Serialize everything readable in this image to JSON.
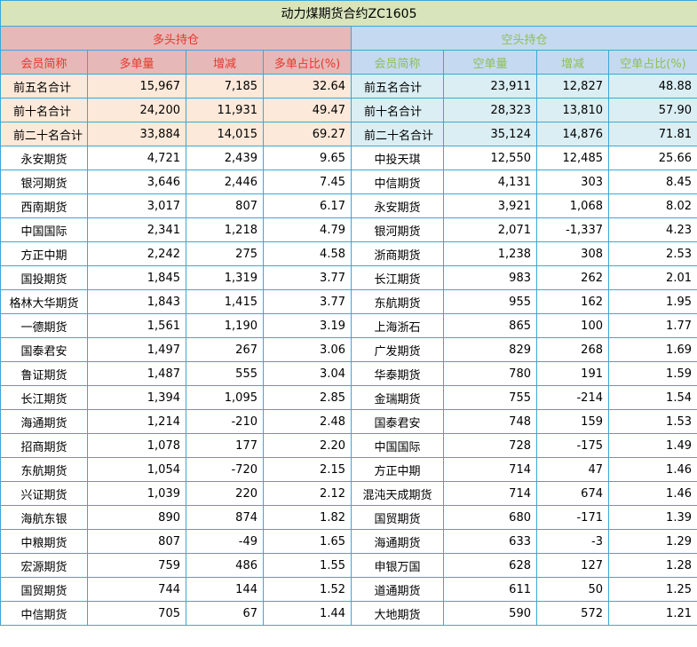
{
  "title": "动力煤期货合约ZC1605",
  "long_section": "多头持仓",
  "short_section": "空头持仓",
  "long_headers": [
    "会员简称",
    "多单量",
    "增减",
    "多单占比(%)"
  ],
  "short_headers": [
    "会员简称",
    "空单量",
    "增减",
    "空单占比(%)"
  ],
  "summary_rows": [
    {
      "long": [
        "前五名合计",
        "15,967",
        "7,185",
        "32.64"
      ],
      "short": [
        "前五名合计",
        "23,911",
        "12,827",
        "48.88"
      ]
    },
    {
      "long": [
        "前十名合计",
        "24,200",
        "11,931",
        "49.47"
      ],
      "short": [
        "前十名合计",
        "28,323",
        "13,810",
        "57.90"
      ]
    },
    {
      "long": [
        "前二十名合计",
        "33,884",
        "14,015",
        "69.27"
      ],
      "short": [
        "前二十名合计",
        "35,124",
        "14,876",
        "71.81"
      ]
    }
  ],
  "rows": [
    {
      "long": [
        "永安期货",
        "4,721",
        "2,439",
        "9.65"
      ],
      "short": [
        "中投天琪",
        "12,550",
        "12,485",
        "25.66"
      ]
    },
    {
      "long": [
        "银河期货",
        "3,646",
        "2,446",
        "7.45"
      ],
      "short": [
        "中信期货",
        "4,131",
        "303",
        "8.45"
      ]
    },
    {
      "long": [
        "西南期货",
        "3,017",
        "807",
        "6.17"
      ],
      "short": [
        "永安期货",
        "3,921",
        "1,068",
        "8.02"
      ]
    },
    {
      "long": [
        "中国国际",
        "2,341",
        "1,218",
        "4.79"
      ],
      "short": [
        "银河期货",
        "2,071",
        "-1,337",
        "4.23"
      ]
    },
    {
      "long": [
        "方正中期",
        "2,242",
        "275",
        "4.58"
      ],
      "short": [
        "浙商期货",
        "1,238",
        "308",
        "2.53"
      ]
    },
    {
      "long": [
        "国投期货",
        "1,845",
        "1,319",
        "3.77"
      ],
      "short": [
        "长江期货",
        "983",
        "262",
        "2.01"
      ]
    },
    {
      "long": [
        "格林大华期货",
        "1,843",
        "1,415",
        "3.77"
      ],
      "short": [
        "东航期货",
        "955",
        "162",
        "1.95"
      ]
    },
    {
      "long": [
        "一德期货",
        "1,561",
        "1,190",
        "3.19"
      ],
      "short": [
        "上海浙石",
        "865",
        "100",
        "1.77"
      ]
    },
    {
      "long": [
        "国泰君安",
        "1,497",
        "267",
        "3.06"
      ],
      "short": [
        "广发期货",
        "829",
        "268",
        "1.69"
      ]
    },
    {
      "long": [
        "鲁证期货",
        "1,487",
        "555",
        "3.04"
      ],
      "short": [
        "华泰期货",
        "780",
        "191",
        "1.59"
      ]
    },
    {
      "long": [
        "长江期货",
        "1,394",
        "1,095",
        "2.85"
      ],
      "short": [
        "金瑞期货",
        "755",
        "-214",
        "1.54"
      ]
    },
    {
      "long": [
        "海通期货",
        "1,214",
        "-210",
        "2.48"
      ],
      "short": [
        "国泰君安",
        "748",
        "159",
        "1.53"
      ]
    },
    {
      "long": [
        "招商期货",
        "1,078",
        "177",
        "2.20"
      ],
      "short": [
        "中国国际",
        "728",
        "-175",
        "1.49"
      ]
    },
    {
      "long": [
        "东航期货",
        "1,054",
        "-720",
        "2.15"
      ],
      "short": [
        "方正中期",
        "714",
        "47",
        "1.46"
      ]
    },
    {
      "long": [
        "兴证期货",
        "1,039",
        "220",
        "2.12"
      ],
      "short": [
        "混沌天成期货",
        "714",
        "674",
        "1.46"
      ]
    },
    {
      "long": [
        "海航东银",
        "890",
        "874",
        "1.82"
      ],
      "short": [
        "国贸期货",
        "680",
        "-171",
        "1.39"
      ]
    },
    {
      "long": [
        "中粮期货",
        "807",
        "-49",
        "1.65"
      ],
      "short": [
        "海通期货",
        "633",
        "-3",
        "1.29"
      ]
    },
    {
      "long": [
        "宏源期货",
        "759",
        "486",
        "1.55"
      ],
      "short": [
        "申银万国",
        "628",
        "127",
        "1.28"
      ]
    },
    {
      "long": [
        "国贸期货",
        "744",
        "144",
        "1.52"
      ],
      "short": [
        "道通期货",
        "611",
        "50",
        "1.25"
      ]
    },
    {
      "long": [
        "中信期货",
        "705",
        "67",
        "1.44"
      ],
      "short": [
        "大地期货",
        "590",
        "572",
        "1.21"
      ]
    }
  ]
}
